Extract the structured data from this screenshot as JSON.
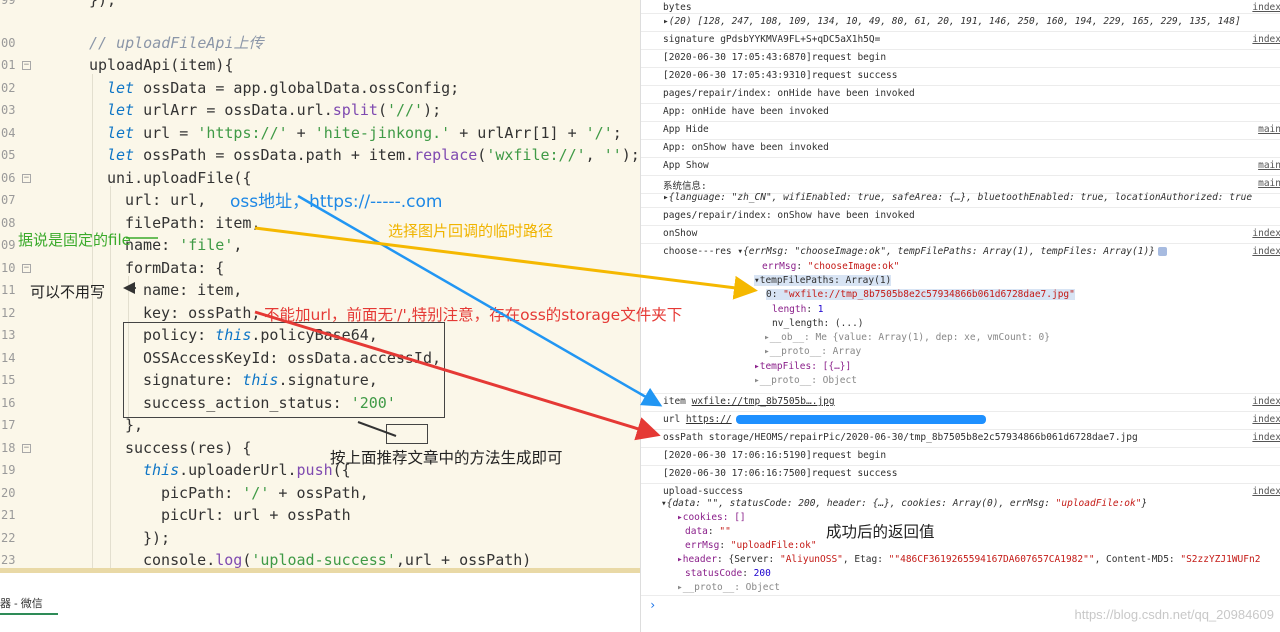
{
  "editor": {
    "line_numbers": [
      "99",
      "00",
      "01",
      "02",
      "03",
      "04",
      "05",
      "06",
      "07",
      "08",
      "09",
      "10",
      "11",
      "12",
      "13",
      "14",
      "15",
      "16",
      "17",
      "18",
      "19",
      "20",
      "21",
      "22",
      "23"
    ],
    "lines": {
      "l99": "});",
      "l00": "// uploadFileApi上传",
      "l01": "uploadApi(item){",
      "l02_kw": "let",
      "l02": " ossData = app.globalData.ossConfig;",
      "l03_kw": "let",
      "l03a": " urlArr = ossData.url.",
      "l03fn": "split",
      "l03b": "(",
      "l03s": "'//'",
      "l03c": ");",
      "l04_kw": "let",
      "l04a": " url = ",
      "l04s1": "'https://'",
      "l04b": " + ",
      "l04s2": "'hite-jinkong.'",
      "l04c": " + urlArr[1] + ",
      "l04s3": "'/'",
      "l04d": ";",
      "l05_kw": "let",
      "l05a": " ossPath = ossData.path + item.",
      "l05fn": "replace",
      "l05b": "(",
      "l05s1": "'wxfile://'",
      "l05c": ", ",
      "l05s2": "''",
      "l05d": ");",
      "l06": "uni.uploadFile({",
      "l07": "url: url,",
      "l08": "filePath: item,",
      "l09a": "name: ",
      "l09s": "'file'",
      "l09b": ",",
      "l10": "formData: {",
      "l11": "name: item,",
      "l12": "key: ossPath,",
      "l13a": "policy: ",
      "l13k": "this",
      "l13b": ".policyBase64,",
      "l14": "OSSAccessKeyId: ossData.accessId,",
      "l15a": "signature: ",
      "l15k": "this",
      "l15b": ".signature,",
      "l16a": "success_action_status: ",
      "l16s": "'200'",
      "l17": "},",
      "l18": "success(res) {",
      "l19k": "this",
      "l19a": ".uploaderUrl.",
      "l19fn": "push",
      "l19b": "({",
      "l20a": "picPath: ",
      "l20s": "'/'",
      "l20b": " + ossPath,",
      "l21": "picUrl: url + ossPath",
      "l22": "});",
      "l23a": "console.",
      "l23fn": "log",
      "l23b": "(",
      "l23s": "'upload-success'",
      "l23c": ",url + ossPath)"
    }
  },
  "bottom_tab": "器 - 微信",
  "annotations": {
    "oss_addr": "oss地址，https://-----.com",
    "fixed_file": "据说是固定的file",
    "temp_path": "选择图片回调的临时路径",
    "optional": "可以不用写",
    "no_url": "不能加url，前面无'/',特别注意，存在oss的storage文件夹下",
    "generate": "按上面推荐文章中的方法生成即可",
    "returned": "成功后的返回值"
  },
  "console": {
    "rows": [
      {
        "msg": "bytes",
        "src": "index"
      },
      {
        "msg": "▸(20) [128, 247, 108, 109, 134, 10, 49, 80, 61, 20, 191, 146, 250, 160, 194, 229, 165, 229, 135, 148]",
        "src": ""
      },
      {
        "msg": "signature gPdsbYYKMVA9FL+S+qDC5aX1h5Q=",
        "src": "index"
      },
      {
        "msg": "[2020-06-30 17:05:43:6870]request begin",
        "src": ""
      },
      {
        "msg": "[2020-06-30 17:05:43:9310]request success",
        "src": ""
      },
      {
        "msg": "pages/repair/index: onHide have been invoked",
        "src": ""
      },
      {
        "msg": "App: onHide have been invoked",
        "src": ""
      },
      {
        "msg": "App Hide",
        "src": "main"
      },
      {
        "msg": "App: onShow have been invoked",
        "src": ""
      },
      {
        "msg": "App Show",
        "src": "main"
      },
      {
        "msg": "系统信息:",
        "src": "main"
      },
      {
        "msg": "pages/repair/index: onShow have been invoked",
        "src": ""
      },
      {
        "msg": "onShow",
        "src": "index"
      }
    ],
    "sysinfo": "▸{language: \"zh_CN\", wifiEnabled: true, safeArea: {…}, bluetoothEnabled: true, locationAuthorized: true",
    "choose_label": "choose---res",
    "choose_obj": "▾{errMsg: \"chooseImage:ok\", tempFilePaths: Array(1), tempFiles: Array(1)}",
    "choose_src": "index",
    "tree": {
      "errMsg": "errMsg: \"chooseImage:ok\"",
      "tempFilePaths": "▾tempFilePaths: Array(1)",
      "path0": "0: \"wxfile://tmp_8b7505b8e2c57934866b061d6728dae7.jpg\"",
      "length": "length: 1",
      "nv_length": "nv_length: (...)",
      "ob": "▸__ob__: Me {value: Array(1), dep: xe, vmCount: 0}",
      "proto1": "▸__proto__: Array",
      "tempFiles": "▸tempFiles: [{…}]",
      "proto2": "▸__proto__: Object"
    },
    "item_row": {
      "label": "item",
      "value": "wxfile://tmp_8b7505b….jpg",
      "src": "index"
    },
    "url_row": {
      "label": "url",
      "value": "https://",
      "src": "index"
    },
    "osspath_row": {
      "msg": "ossPath storage/HEOMS/repairPic/2020-06-30/tmp_8b7505b8e2c57934866b061d6728dae7.jpg",
      "src": "index"
    },
    "req_begin": "[2020-06-30 17:06:16:5190]request begin",
    "req_success": "[2020-06-30 17:06:16:7500]request success",
    "upload_label": "upload-success",
    "upload_src": "index",
    "upload_obj": "▾{data: \"\", statusCode: 200, header: {…}, cookies: Array(0), errMsg: \"uploadFile:ok\"}",
    "utree": {
      "cookies": "▸cookies: []",
      "data": "data: \"\"",
      "errMsg": "errMsg: \"uploadFile:ok\"",
      "header": "▸header: {Server: \"AliyunOSS\", Etag: \"\"486CF3619265594167DA607657CA1982\"\", Content-MD5: \"S2zzYZJ1WUFn2",
      "statusCode": "statusCode: 200",
      "proto": "▸__proto__: Object"
    },
    "prompt": "›",
    "watermark": "https://blog.csdn.net/qq_20984609"
  }
}
